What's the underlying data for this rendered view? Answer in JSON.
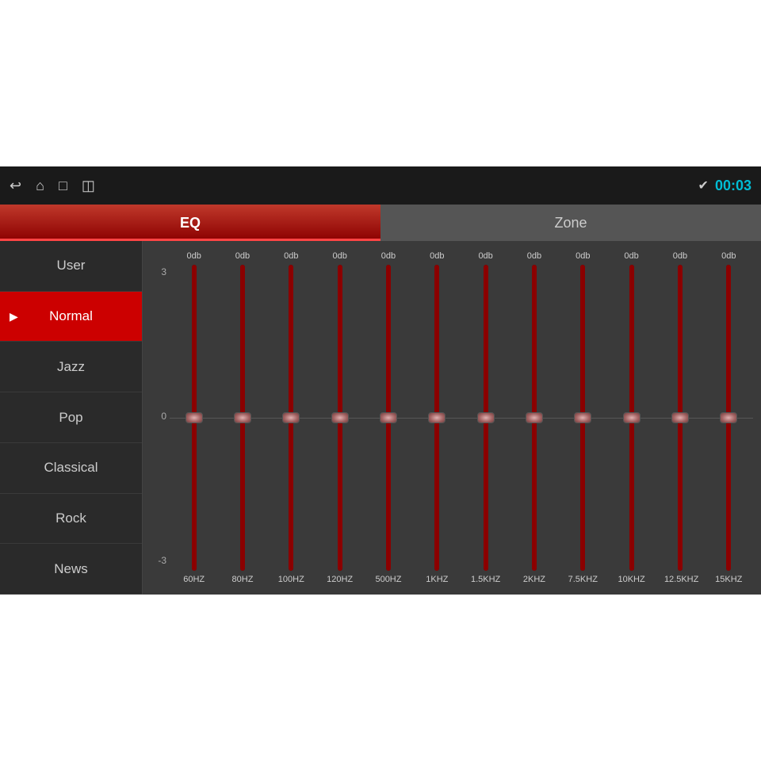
{
  "topbar": {
    "time": "00:03",
    "icons": [
      "back",
      "home",
      "window",
      "image"
    ]
  },
  "tabs": [
    {
      "id": "eq",
      "label": "EQ",
      "active": true
    },
    {
      "id": "zone",
      "label": "Zone",
      "active": false
    }
  ],
  "sidebar": {
    "items": [
      {
        "id": "user",
        "label": "User",
        "active": false
      },
      {
        "id": "normal",
        "label": "Normal",
        "active": true
      },
      {
        "id": "jazz",
        "label": "Jazz",
        "active": false
      },
      {
        "id": "pop",
        "label": "Pop",
        "active": false
      },
      {
        "id": "classical",
        "label": "Classical",
        "active": false
      },
      {
        "id": "rock",
        "label": "Rock",
        "active": false
      },
      {
        "id": "news",
        "label": "News",
        "active": false
      }
    ]
  },
  "eq": {
    "yLabels": [
      "3",
      "0",
      "-3"
    ],
    "bands": [
      {
        "freq": "60HZ",
        "db": "0db",
        "value": 0
      },
      {
        "freq": "80HZ",
        "db": "0db",
        "value": 0
      },
      {
        "freq": "100HZ",
        "db": "0db",
        "value": 0
      },
      {
        "freq": "120HZ",
        "db": "0db",
        "value": 0
      },
      {
        "freq": "500HZ",
        "db": "0db",
        "value": 0
      },
      {
        "freq": "1KHZ",
        "db": "0db",
        "value": 0
      },
      {
        "freq": "1.5KHZ",
        "db": "0db",
        "value": 0
      },
      {
        "freq": "2KHZ",
        "db": "0db",
        "value": 0
      },
      {
        "freq": "7.5KHZ",
        "db": "0db",
        "value": 0
      },
      {
        "freq": "10KHZ",
        "db": "0db",
        "value": 0
      },
      {
        "freq": "12.5KHZ",
        "db": "0db",
        "value": 0
      },
      {
        "freq": "15KHZ",
        "db": "0db",
        "value": 0
      }
    ]
  },
  "colors": {
    "active_tab_bg_start": "#c0392b",
    "active_tab_bg_end": "#8b0000",
    "active_sidebar": "#cc0000",
    "time_color": "#00bcd4"
  }
}
